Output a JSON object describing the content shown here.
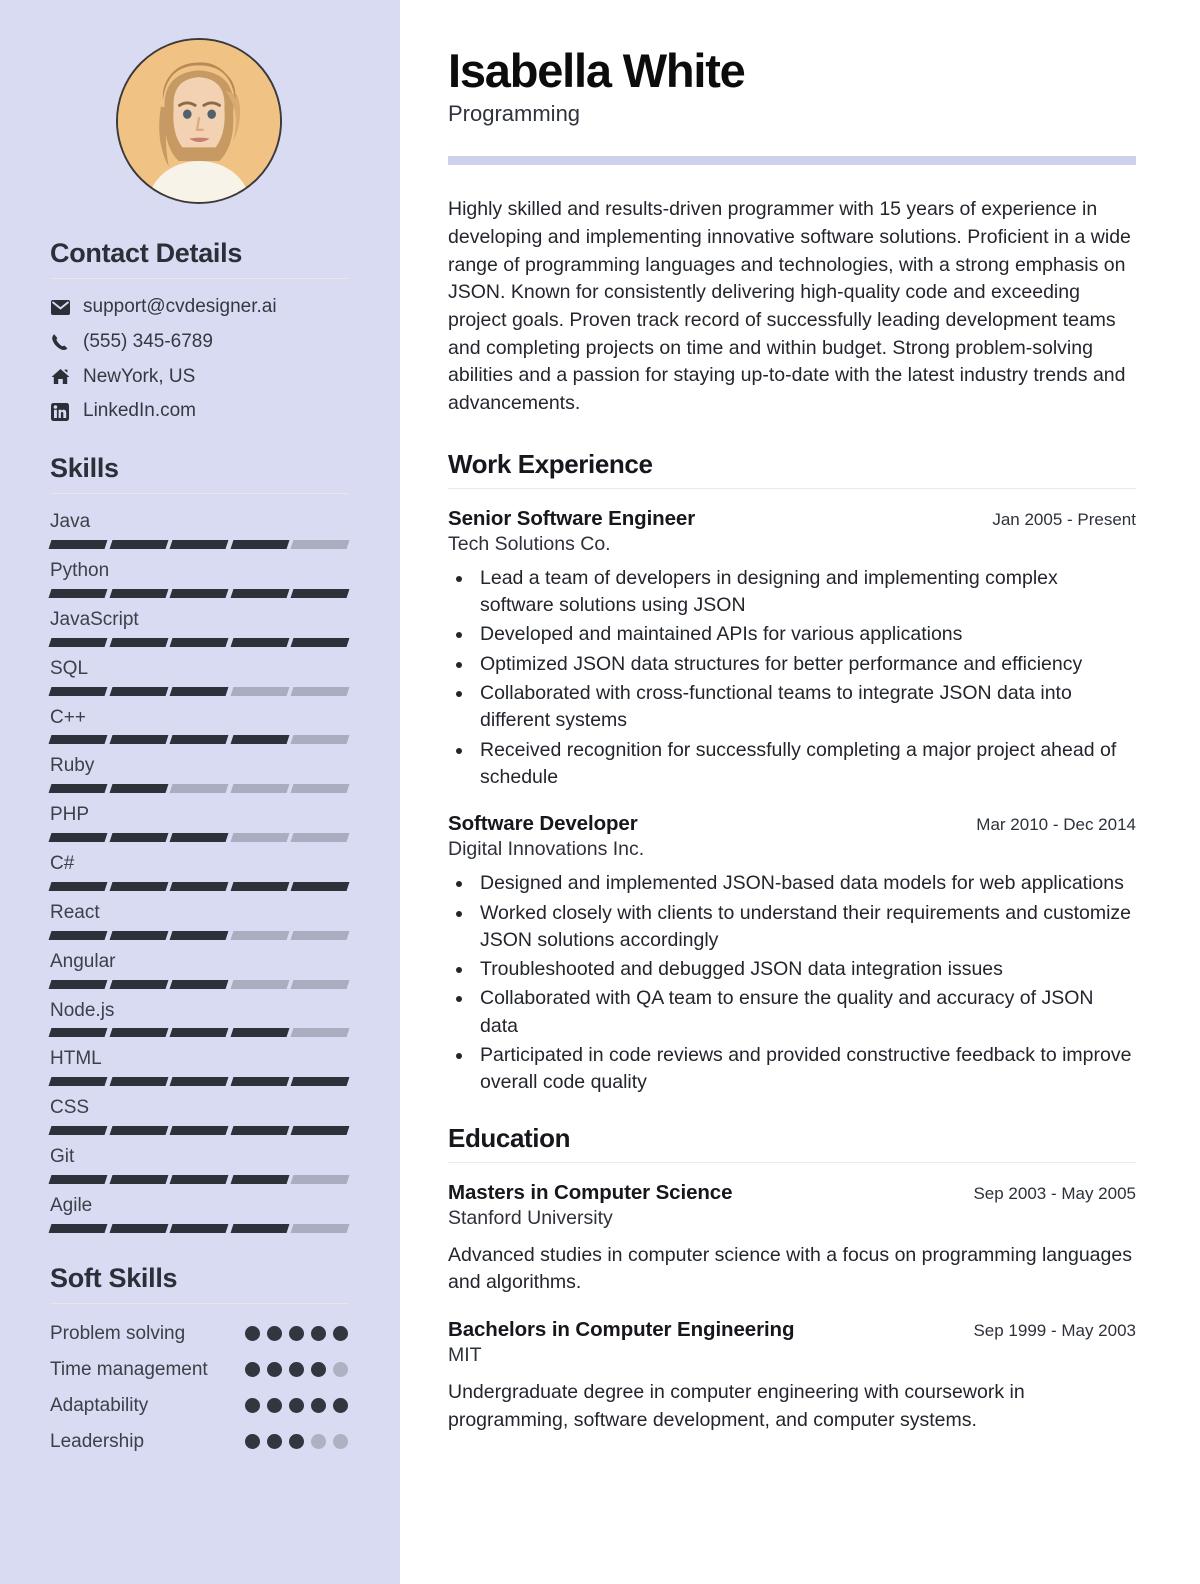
{
  "sidebar": {
    "avatar": {
      "icon": "user-photo-avatar",
      "bg_color": "#f0c385"
    },
    "contact": {
      "heading": "Contact Details",
      "items": [
        {
          "icon": "envelope-icon",
          "text": "support@cvdesigner.ai"
        },
        {
          "icon": "phone-icon",
          "text": "(555) 345-6789"
        },
        {
          "icon": "home-icon",
          "text": "NewYork, US"
        },
        {
          "icon": "linkedin-icon",
          "text": "LinkedIn.com"
        }
      ]
    },
    "skills": {
      "heading": "Skills",
      "max_level": 5,
      "items": [
        {
          "name": "Java",
          "level": 4
        },
        {
          "name": "Python",
          "level": 5
        },
        {
          "name": "JavaScript",
          "level": 5
        },
        {
          "name": "SQL",
          "level": 3
        },
        {
          "name": "C++",
          "level": 4
        },
        {
          "name": "Ruby",
          "level": 2
        },
        {
          "name": "PHP",
          "level": 3
        },
        {
          "name": "C#",
          "level": 5
        },
        {
          "name": "React",
          "level": 3
        },
        {
          "name": "Angular",
          "level": 3
        },
        {
          "name": "Node.js",
          "level": 4
        },
        {
          "name": "HTML",
          "level": 5
        },
        {
          "name": "CSS",
          "level": 5
        },
        {
          "name": "Git",
          "level": 4
        },
        {
          "name": "Agile",
          "level": 4
        }
      ]
    },
    "soft_skills": {
      "heading": "Soft Skills",
      "max_level": 5,
      "items": [
        {
          "name": "Problem solving",
          "level": 5
        },
        {
          "name": "Time management",
          "level": 4
        },
        {
          "name": "Adaptability",
          "level": 5
        },
        {
          "name": "Leadership",
          "level": 3
        }
      ]
    }
  },
  "main": {
    "name": "Isabella White",
    "role": "Programming",
    "summary": "Highly skilled and results-driven programmer with 15 years of experience in developing and implementing innovative software solutions. Proficient in a wide range of programming languages and technologies, with a strong emphasis on JSON. Known for consistently delivering high-quality code and exceeding project goals. Proven track record of successfully leading development teams and completing projects on time and within budget. Strong problem-solving abilities and a passion for staying up-to-date with the latest industry trends and advancements.",
    "work": {
      "heading": "Work Experience",
      "entries": [
        {
          "title": "Senior Software Engineer",
          "date": "Jan 2005 - Present",
          "org": "Tech Solutions Co.",
          "bullets": [
            "Lead a team of developers in designing and implementing complex software solutions using JSON",
            "Developed and maintained APIs for various applications",
            "Optimized JSON data structures for better performance and efficiency",
            "Collaborated with cross-functional teams to integrate JSON data into different systems",
            "Received recognition for successfully completing a major project ahead of schedule"
          ]
        },
        {
          "title": "Software Developer",
          "date": "Mar 2010 - Dec 2014",
          "org": "Digital Innovations Inc.",
          "bullets": [
            "Designed and implemented JSON-based data models for web applications",
            "Worked closely with clients to understand their requirements and customize JSON solutions accordingly",
            "Troubleshooted and debugged JSON data integration issues",
            "Collaborated with QA team to ensure the quality and accuracy of JSON data",
            "Participated in code reviews and provided constructive feedback to improve overall code quality"
          ]
        }
      ]
    },
    "education": {
      "heading": "Education",
      "entries": [
        {
          "title": "Masters in Computer Science",
          "date": "Sep 2003 - May 2005",
          "org": "Stanford University",
          "description": "Advanced studies in computer science with a focus on programming languages and algorithms."
        },
        {
          "title": "Bachelors in Computer Engineering",
          "date": "Sep 1999 - May 2003",
          "org": "MIT",
          "description": "Undergraduate degree in computer engineering with coursework in programming, software development, and computer systems."
        }
      ]
    }
  }
}
